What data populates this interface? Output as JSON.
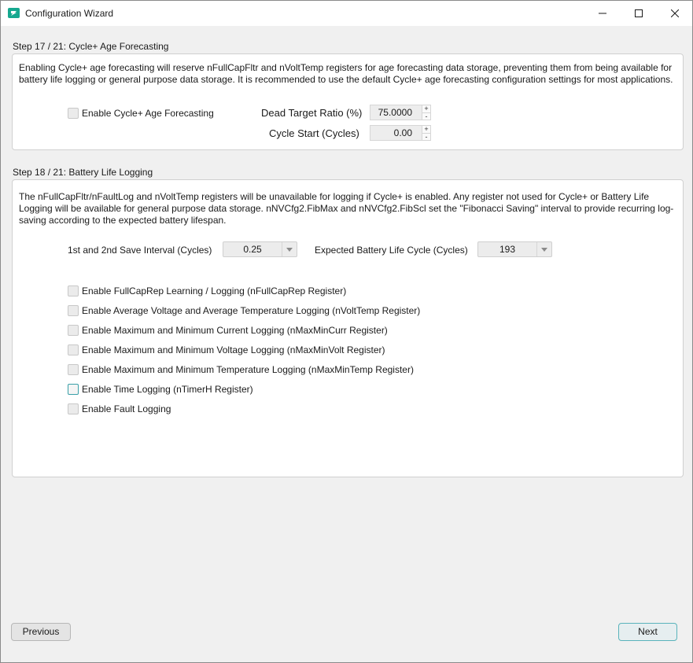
{
  "window": {
    "title": "Configuration Wizard",
    "controls": {
      "minimize": "minimize-icon",
      "maximize": "maximize-icon",
      "close": "close-icon"
    }
  },
  "step17": {
    "header": "Step 17 / 21: Cycle+ Age Forecasting",
    "description": "Enabling Cycle+ age forecasting will reserve nFullCapFltr and nVoltTemp registers for age forecasting data storage, preventing them from being available for battery life logging or general purpose data storage. It is recommended to use the default Cycle+ age forecasting configuration settings for most applications.",
    "enable_label": "Enable Cycle+ Age Forecasting",
    "dead_target_label": "Dead Target Ratio (%)",
    "dead_target_value": "75.0000",
    "cycle_start_label": "Cycle Start (Cycles)",
    "cycle_start_value": "0.00"
  },
  "step18": {
    "header": "Step 18 / 21: Battery Life Logging",
    "description": "The nFullCapFltr/nFaultLog and nVoltTemp registers will be unavailable for logging if Cycle+ is enabled. Any register not used for Cycle+ or Battery Life Logging will be available for general purpose data storage. nNVCfg2.FibMax and nNVCfg2.FibScl set the \"Fibonacci Saving\" interval to provide recurring log-saving according to the expected battery lifespan.",
    "save_interval_label": "1st and 2nd Save Interval (Cycles)",
    "save_interval_value": "0.25",
    "life_cycle_label": "Expected Battery Life Cycle (Cycles)",
    "life_cycle_value": "193",
    "options": [
      "Enable FullCapRep Learning / Logging (nFullCapRep Register)",
      "Enable Average Voltage and Average Temperature Logging (nVoltTemp Register)",
      "Enable Maximum and Minimum Current Logging (nMaxMinCurr Register)",
      "Enable Maximum and Minimum Voltage Logging (nMaxMinVolt Register)",
      "Enable Maximum and Minimum Temperature Logging (nMaxMinTemp Register)",
      "Enable Time Logging (nTimerH Register)",
      "Enable Fault Logging"
    ]
  },
  "footer": {
    "previous_label": "Previous",
    "next_label": "Next"
  },
  "spin_up": "+",
  "spin_down": "-",
  "colors": {
    "accent": "#16a88f",
    "focus": "#5ab3bb"
  }
}
